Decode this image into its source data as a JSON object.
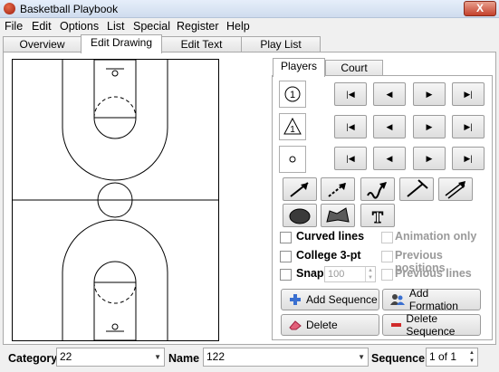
{
  "window": {
    "title": "Basketball Playbook",
    "close": "X"
  },
  "menu": [
    "File",
    "Edit",
    "Options",
    "List",
    "Special",
    "Register",
    "Help"
  ],
  "tabs": [
    "Overview",
    "Edit Drawing",
    "Edit Text",
    "Play List"
  ],
  "subtabs": [
    "Players",
    "Court"
  ],
  "players": {
    "offense_symbol": "1"
  },
  "options": {
    "curved_lines": "Curved lines",
    "college_3pt": "College 3-pt",
    "snap": "Snap",
    "snap_value": "100",
    "animation_only": "Animation only",
    "previous_positions": "Previous positions",
    "previous_lines": "Previous lines"
  },
  "buttons": {
    "add_sequence": "Add Sequence",
    "add_formation": "Add Formation",
    "delete": "Delete",
    "delete_sequence": "Delete Sequence"
  },
  "bottom": {
    "category_label": "Category",
    "category_value": "22",
    "name_label": "Name",
    "name_value": "122",
    "sequence_label": "Sequence",
    "sequence_value": "1 of 1"
  },
  "colors": {
    "add_icon": "#3a6fd0",
    "delete_icon": "#d02a2a",
    "accent_red": "#c4402c"
  }
}
